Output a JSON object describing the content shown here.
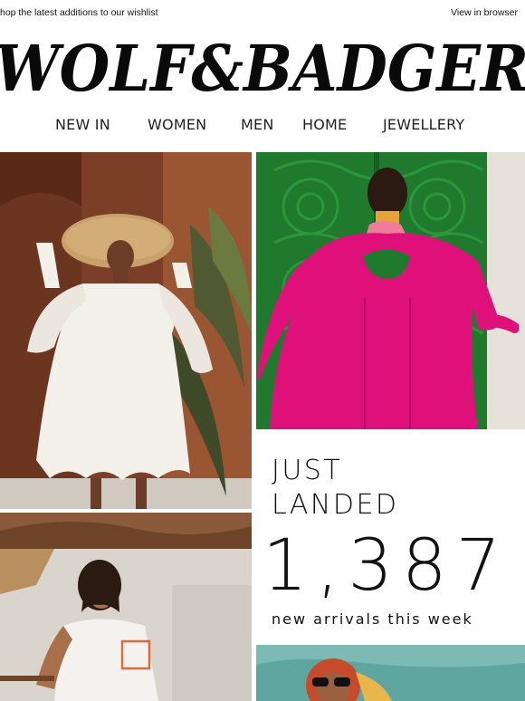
{
  "header": {
    "pre_header": "hop the latest additions to our wishlist",
    "view_in_browser": "View in browser",
    "logo_text": "WOLF&BADGER"
  },
  "nav": {
    "items": [
      {
        "label": "NEW IN"
      },
      {
        "label": "WOMEN"
      },
      {
        "label": "MEN"
      },
      {
        "label": "HOME"
      },
      {
        "label": "JEWELLERY"
      }
    ]
  },
  "promo": {
    "line1": "JUST",
    "line2": "LANDED",
    "count": "1,387",
    "subtitle": "new arrivals this week"
  },
  "colors": {
    "dress_pink": "#e0107a",
    "door_green": "#1f7a2e",
    "wall_terracotta": "#8a4a2c",
    "dress_white": "#f3f0ea",
    "pool_teal": "#5fa6a1"
  },
  "images": {
    "tile1": "woman-white-dress-straw-hat-image",
    "tile2": "woman-pink-coat-green-door-image",
    "tile3": "woman-white-tshirt-image",
    "tile4": "woman-sunglasses-headscarf-image"
  }
}
